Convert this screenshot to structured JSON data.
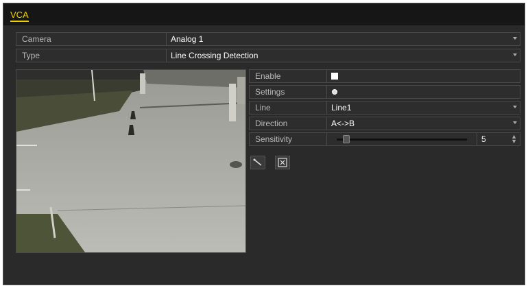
{
  "header": {
    "tab_label": "VCA"
  },
  "camera": {
    "label": "Camera",
    "value": "Analog 1"
  },
  "type": {
    "label": "Type",
    "value": "Line Crossing Detection"
  },
  "settings_panel": {
    "enable_label": "Enable",
    "enable_checked": true,
    "settings_label": "Settings",
    "line_label": "Line",
    "line_value": "Line1",
    "direction_label": "Direction",
    "direction_value": "A<->B",
    "sensitivity_label": "Sensitivity",
    "sensitivity_value": "5",
    "sensitivity_level": 0.05
  },
  "tools": {
    "draw_icon": "draw-line-icon",
    "clear_icon": "clear-icon"
  },
  "colors": {
    "accent": "#f0d000",
    "panel": "#2a2a2a",
    "titlebar": "#161616"
  }
}
